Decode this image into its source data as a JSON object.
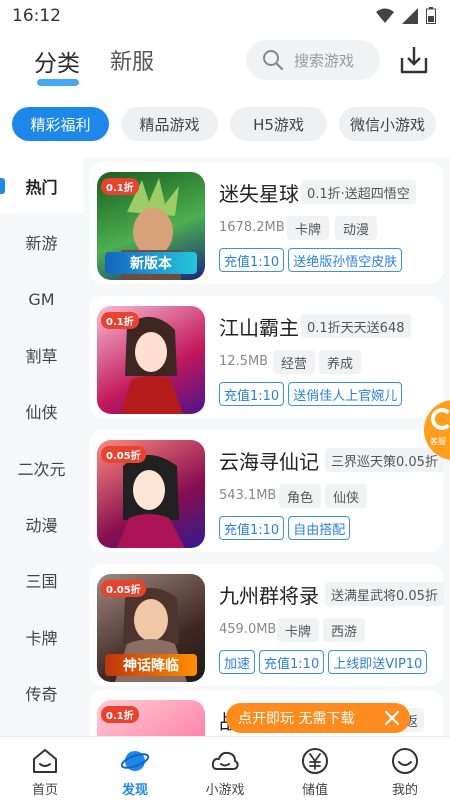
{
  "status": {
    "time": "16:12"
  },
  "header": {
    "tabs": [
      {
        "label": "分类"
      },
      {
        "label": "新服"
      }
    ],
    "search_placeholder": "搜索游戏"
  },
  "chips": [
    {
      "label": "精彩福利",
      "active": true
    },
    {
      "label": "精品游戏",
      "active": false
    },
    {
      "label": "H5游戏",
      "active": false
    },
    {
      "label": "微信小游戏",
      "active": false
    }
  ],
  "sidebar": {
    "items": [
      {
        "label": "热门"
      },
      {
        "label": "新游"
      },
      {
        "label": "GM"
      },
      {
        "label": "割草"
      },
      {
        "label": "仙侠"
      },
      {
        "label": "二次元"
      },
      {
        "label": "动漫"
      },
      {
        "label": "三国"
      },
      {
        "label": "卡牌"
      },
      {
        "label": "传奇"
      }
    ]
  },
  "games": [
    {
      "name": "迷失星球",
      "promo": "0.1折·送超四悟空",
      "size": "1678.2MB",
      "tags": [
        "卡牌",
        "动漫"
      ],
      "boxes": [
        "充值1:10",
        "送绝版孙悟空皮肤"
      ],
      "badge": "0.1折",
      "banner": "新版本",
      "colors": [
        "#1b5e20",
        "#4caf50"
      ]
    },
    {
      "name": "江山霸主",
      "promo": "0.1折天天送648",
      "size": "12.5MB",
      "tags": [
        "经营",
        "养成"
      ],
      "boxes": [
        "充值1:10",
        "送俏佳人上官婉儿"
      ],
      "badge": "0.1折",
      "banner": "",
      "colors": [
        "#c2185b",
        "#f8bbd0"
      ]
    },
    {
      "name": "云海寻仙记",
      "promo": "三界巡天策0.05折",
      "size": "543.1MB",
      "tags": [
        "角色",
        "仙侠"
      ],
      "boxes": [
        "充值1:10",
        "自由搭配"
      ],
      "badge": "0.05折",
      "banner": "",
      "colors": [
        "#880e4f",
        "#ff8a80"
      ]
    },
    {
      "name": "九州群将录",
      "promo": "送满星武将0.05折",
      "size": "459.0MB",
      "tags": [
        "卡牌",
        "西游"
      ],
      "boxes": [
        "加速",
        "充值1:10",
        "上线即送VIP10"
      ],
      "badge": "0.05折",
      "banner": "神话降临",
      "colors": [
        "#3e2723",
        "#a1887f"
      ]
    },
    {
      "name": "战",
      "promo": "返",
      "size": "",
      "tags": [],
      "boxes": [],
      "badge": "0.1折",
      "banner": "",
      "colors": [
        "#ff80ab",
        "#ffcdd2"
      ]
    }
  ],
  "float_tab": {
    "label": "客服"
  },
  "toast": {
    "text": "点开即玩 无需下载"
  },
  "bottom_nav": [
    {
      "label": "首页",
      "icon": "home-icon",
      "active": false
    },
    {
      "label": "发现",
      "icon": "planet-icon",
      "active": true
    },
    {
      "label": "小游戏",
      "icon": "cloud-icon",
      "active": false
    },
    {
      "label": "储值",
      "icon": "yuan-icon",
      "active": false
    },
    {
      "label": "我的",
      "icon": "smile-icon",
      "active": false
    }
  ],
  "colors": {
    "accent": "#1e88ea",
    "toast": "#ff8a1d",
    "float": "#ff9d1c"
  }
}
